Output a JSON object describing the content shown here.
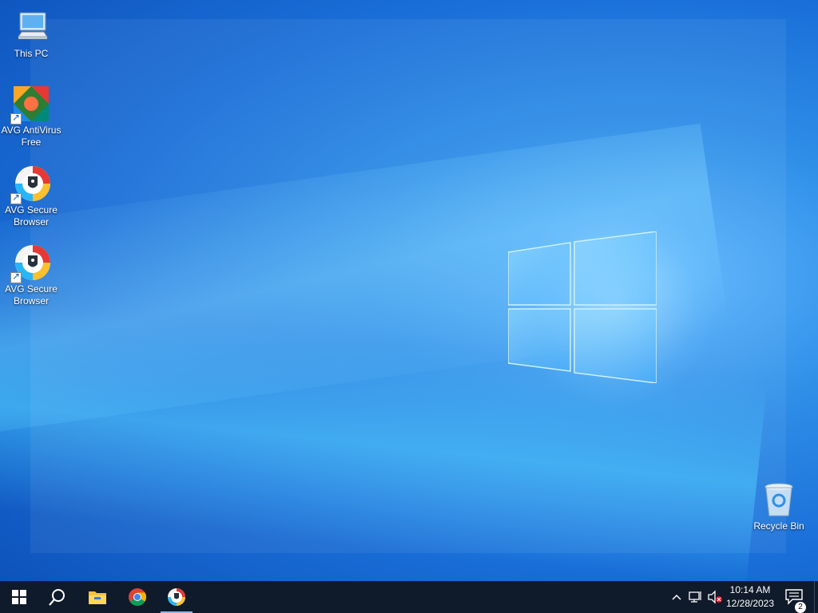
{
  "desktop": {
    "icons": [
      {
        "label": "This PC"
      },
      {
        "label": "AVG AntiVirus Free"
      },
      {
        "label": "AVG Secure Browser"
      },
      {
        "label": "AVG Secure Browser"
      },
      {
        "label": "Recycle Bin"
      }
    ]
  },
  "taskbar": {
    "apps": [
      {
        "icon": "windows-start-icon"
      },
      {
        "icon": "search-icon"
      },
      {
        "icon": "file-explorer-icon"
      },
      {
        "icon": "chrome-icon"
      },
      {
        "icon": "avg-secure-browser-icon"
      }
    ],
    "clock": {
      "time": "10:14 AM",
      "date": "12/28/2023"
    },
    "notification_count": "2"
  },
  "colors": {
    "taskbar": "#0f1a2a",
    "accent": "#1a6fd8"
  }
}
